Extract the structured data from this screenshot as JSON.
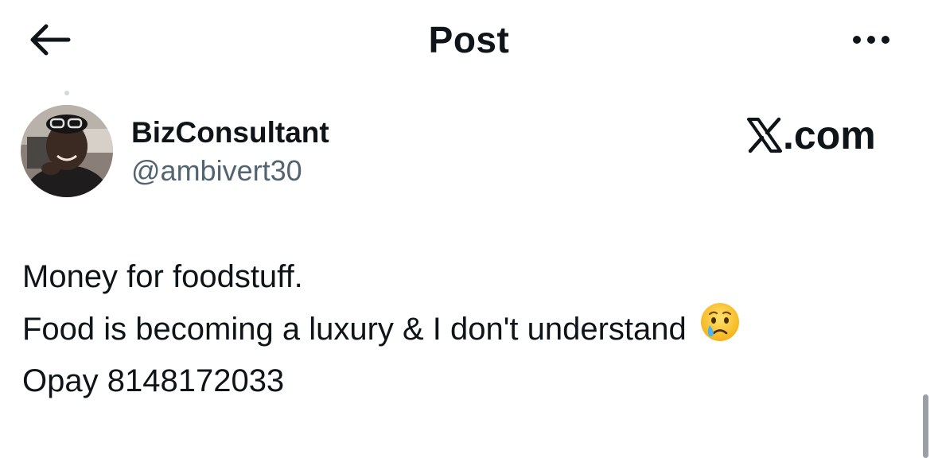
{
  "header": {
    "back_icon": "arrow-left-icon",
    "title": "Post",
    "more_icon": "more-horizontal-icon"
  },
  "author": {
    "display_name": "BizConsultant",
    "handle": "@ambivert30",
    "avatar_icon": "profile-photo"
  },
  "watermark": {
    "text": ".com",
    "logo_letter": "X"
  },
  "post": {
    "lines": [
      "Money for foodstuff.",
      "Food is becoming a luxury & I don't understand",
      "Opay 8148172033"
    ],
    "emoji": "crying-face-emoji"
  },
  "colors": {
    "text_primary": "#0f1419",
    "text_secondary": "#536471",
    "background": "#ffffff"
  }
}
